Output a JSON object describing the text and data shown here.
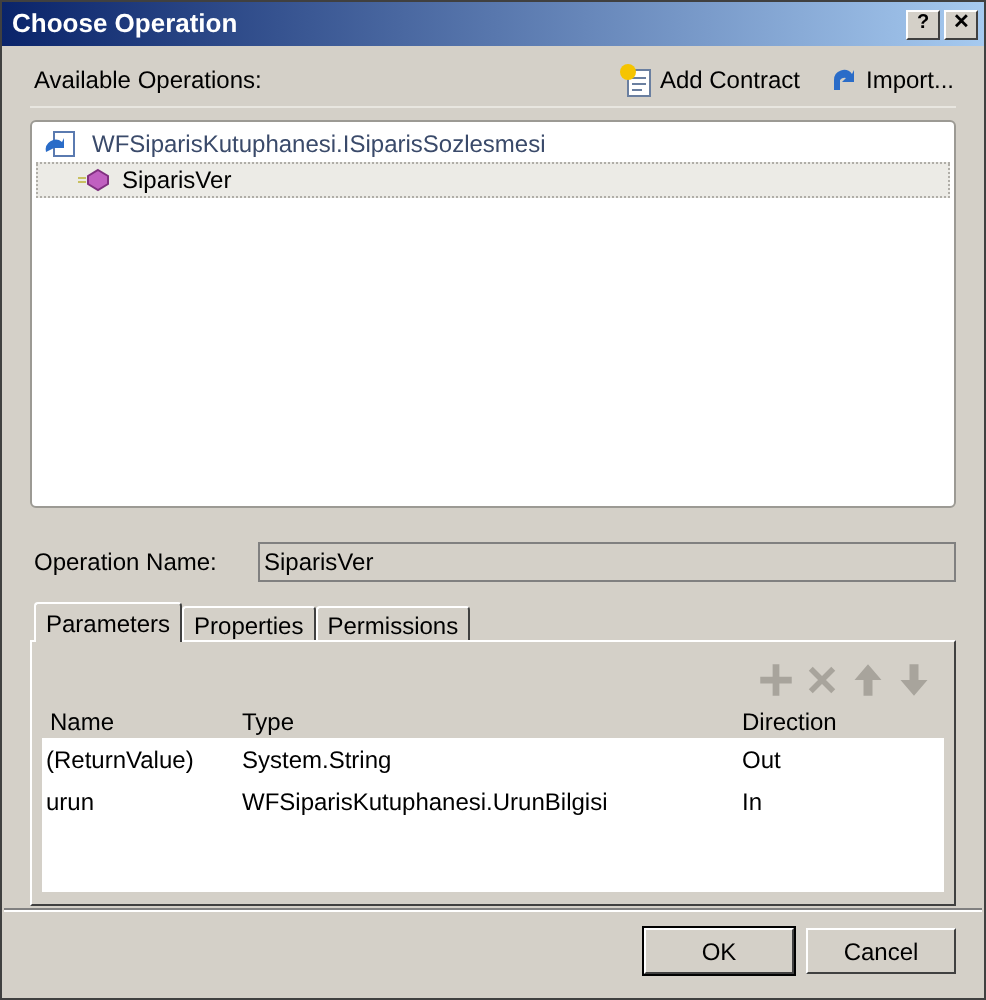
{
  "window": {
    "title": "Choose Operation",
    "controls": [
      "?",
      "✕"
    ]
  },
  "header": {
    "label": "Available Operations:",
    "actions": [
      {
        "kind": "add",
        "label": "Add Contract"
      },
      {
        "kind": "import",
        "label": "Import..."
      }
    ]
  },
  "tree": [
    {
      "label": "WFSiparisKutuphanesi.ISiparisSozlesmesi",
      "selected": false,
      "children": [
        {
          "label": "SiparisVer",
          "selected": true
        }
      ]
    }
  ],
  "operation_name": {
    "label": "Operation Name:",
    "value": "SiparisVer"
  },
  "tabs": [
    {
      "label": "Parameters",
      "selected": true
    },
    {
      "label": "Properties",
      "selected": false
    },
    {
      "label": "Permissions",
      "selected": false
    }
  ],
  "toolbar": [
    {
      "kind": "add",
      "disabled": true
    },
    {
      "kind": "delete",
      "disabled": true
    },
    {
      "kind": "up",
      "disabled": true
    },
    {
      "kind": "down",
      "disabled": true
    }
  ],
  "table": {
    "columns": [
      "Name",
      "Type",
      "Direction"
    ],
    "rows": [
      {
        "cells": [
          "(ReturnValue)",
          "System.String",
          "Out"
        ]
      },
      {
        "cells": [
          "urun",
          "WFSiparisKutuphanesi.UrunBilgisi",
          "In"
        ]
      }
    ]
  },
  "buttons": [
    {
      "label": "OK",
      "default": true
    },
    {
      "label": "Cancel",
      "default": false
    }
  ]
}
